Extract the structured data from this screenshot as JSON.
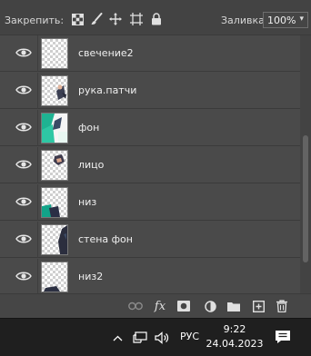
{
  "lock_bar": {
    "label": "Закрепить:",
    "fill_label": "Заливка:",
    "fill_value": "100%"
  },
  "layers": [
    {
      "name": "свечение2",
      "visible": true
    },
    {
      "name": "рука.патчи",
      "visible": true
    },
    {
      "name": "фон",
      "visible": true
    },
    {
      "name": "лицо",
      "visible": true
    },
    {
      "name": "низ",
      "visible": true
    },
    {
      "name": "стена фон",
      "visible": true
    },
    {
      "name": "низ2",
      "visible": true
    }
  ],
  "bottom_icons": [
    "link-layers-icon",
    "fx-icon",
    "add-mask-icon",
    "adjustment-layer-icon",
    "new-group-icon",
    "new-layer-icon",
    "delete-layer-icon"
  ],
  "bottom_fx_label": "fx",
  "taskbar": {
    "language": "РУС",
    "time": "9:22",
    "date": "24.04.2023"
  }
}
